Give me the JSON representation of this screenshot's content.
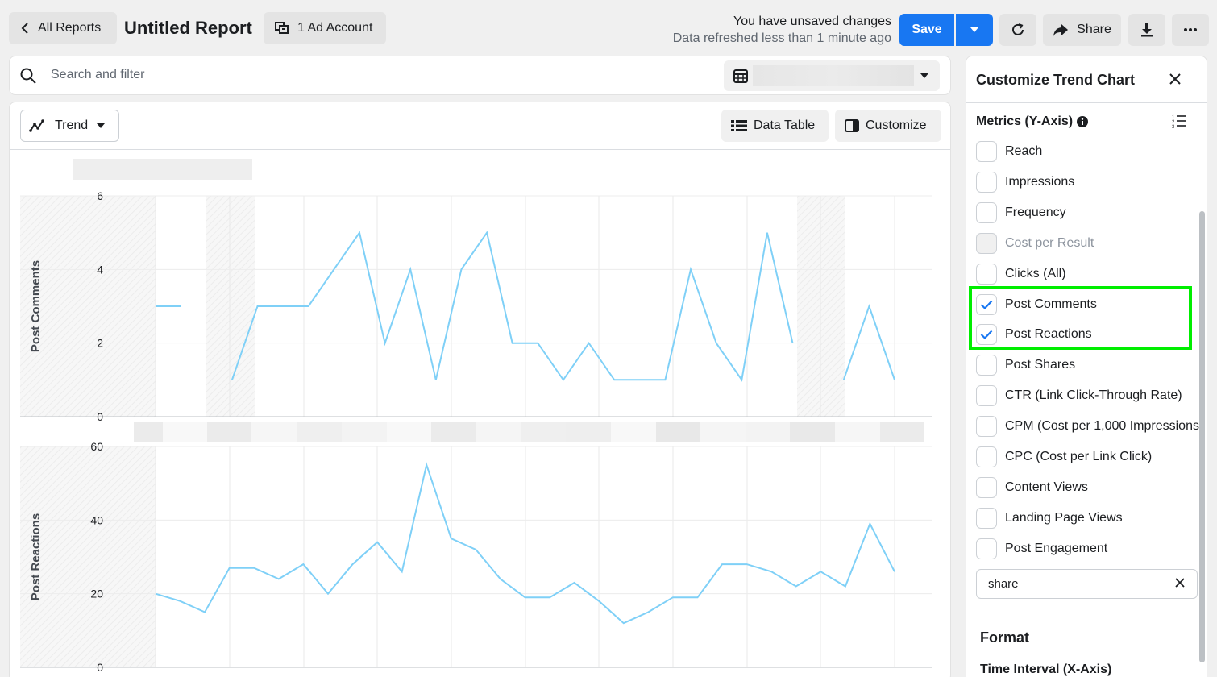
{
  "header": {
    "back_label": "All Reports",
    "report_title": "Untitled Report",
    "account_label": "1 Ad Account",
    "status_main": "You have unsaved changes",
    "status_sub": "Data refreshed less than 1 minute ago",
    "save_label": "Save",
    "share_label": "Share"
  },
  "search": {
    "placeholder": "Search and filter"
  },
  "toolbar": {
    "chart_type_label": "Trend",
    "data_table_label": "Data Table",
    "customize_label": "Customize"
  },
  "panel": {
    "title": "Customize Trend Chart",
    "metrics_header": "Metrics (Y-Axis)",
    "metrics": [
      {
        "label": "Reach",
        "checked": false,
        "disabled": false
      },
      {
        "label": "Impressions",
        "checked": false,
        "disabled": false
      },
      {
        "label": "Frequency",
        "checked": false,
        "disabled": false
      },
      {
        "label": "Cost per Result",
        "checked": false,
        "disabled": true
      },
      {
        "label": "Clicks (All)",
        "checked": false,
        "disabled": false
      },
      {
        "label": "Post Comments",
        "checked": true,
        "disabled": false
      },
      {
        "label": "Post Reactions",
        "checked": true,
        "disabled": false
      },
      {
        "label": "Post Shares",
        "checked": false,
        "disabled": false
      },
      {
        "label": "CTR (Link Click-Through Rate)",
        "checked": false,
        "disabled": false
      },
      {
        "label": "CPM (Cost per 1,000 Impressions)",
        "checked": false,
        "disabled": false
      },
      {
        "label": "CPC (Cost per Link Click)",
        "checked": false,
        "disabled": false
      },
      {
        "label": "Content Views",
        "checked": false,
        "disabled": false
      },
      {
        "label": "Landing Page Views",
        "checked": false,
        "disabled": false
      },
      {
        "label": "Post Engagement",
        "checked": false,
        "disabled": false
      }
    ],
    "filter_value": "share",
    "format_header": "Format",
    "interval_header": "Time Interval (X-Axis)"
  },
  "colors": {
    "accent": "#1877f2",
    "line": "#7fd0f7",
    "highlight": "#00ee00"
  },
  "chart_data": [
    {
      "type": "line",
      "ylabel": "Post Comments",
      "ylim": [
        0,
        6
      ],
      "yticks": [
        "0",
        "2",
        "4",
        "6"
      ],
      "values": [
        3,
        3,
        null,
        1,
        3,
        3,
        3,
        4,
        5,
        2,
        4,
        1,
        4,
        5,
        2,
        2,
        1,
        2,
        1,
        1,
        1,
        4,
        2,
        1,
        5,
        2,
        null,
        1,
        3,
        1
      ]
    },
    {
      "type": "line",
      "ylabel": "Post Reactions",
      "ylim": [
        0,
        60
      ],
      "yticks": [
        "0",
        "20",
        "40",
        "60"
      ],
      "values": [
        20,
        18,
        15,
        27,
        27,
        24,
        28,
        20,
        28,
        34,
        26,
        55,
        35,
        32,
        24,
        19,
        19,
        23,
        18,
        12,
        15,
        19,
        19,
        28,
        28,
        26,
        22,
        26,
        22,
        39,
        26
      ]
    }
  ]
}
